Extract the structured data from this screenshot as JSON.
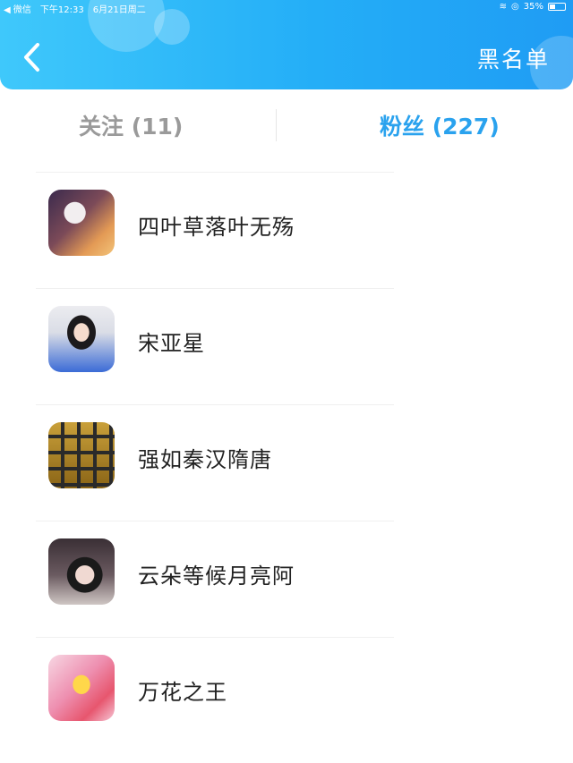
{
  "status_bar": {
    "carrier": "◀ 微信",
    "time": "下午12:33",
    "date": "6月21日周二",
    "battery_percent": "35%"
  },
  "header": {
    "back_icon": "chevron-left-icon",
    "right_action": "黑名单",
    "gradient_colors": [
      "#3fc8fb",
      "#1f9cf4"
    ]
  },
  "tabs": [
    {
      "label": "关注 (11)",
      "active": false
    },
    {
      "label": "粉丝 (227)",
      "active": true
    }
  ],
  "accent_color": "#2aa2ee",
  "fans": [
    {
      "name": "四叶草落叶无殇"
    },
    {
      "name": "宋亚星"
    },
    {
      "name": "强如秦汉隋唐"
    },
    {
      "name": "云朵等候月亮阿"
    },
    {
      "name": "万花之王"
    }
  ]
}
